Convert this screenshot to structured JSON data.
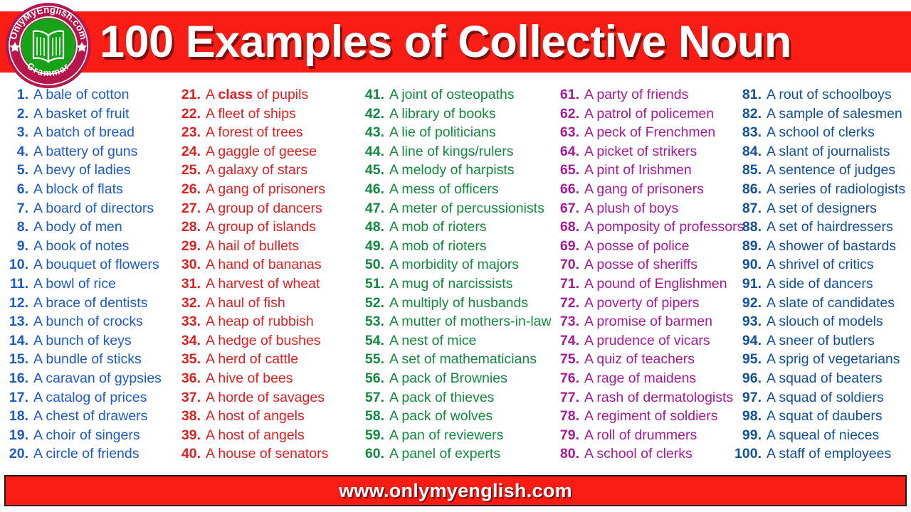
{
  "header": {
    "title": "100 Examples of Collective Noun",
    "background_color": "#F91C15",
    "title_color": "#FFFFFF"
  },
  "logo": {
    "top_text": "OnlyMyEnglish.com",
    "bottom_text": "Grammar",
    "ring_color": "#B5174A",
    "inner_color": "#17A317",
    "icon": "open-book-icon"
  },
  "footer": {
    "url": "www.onlymyenglish.com",
    "background_color": "#F91C15",
    "text_color": "#FFFFFF"
  },
  "columns": [
    {
      "color": "#1A5BC4",
      "items": [
        {
          "num": "1.",
          "text": "A bale of cotton"
        },
        {
          "num": "2.",
          "text": "A basket of fruit"
        },
        {
          "num": "3.",
          "text": "A batch of bread"
        },
        {
          "num": "4.",
          "text": "A battery of guns"
        },
        {
          "num": "5.",
          "text": "A bevy of ladies"
        },
        {
          "num": "6.",
          "text": "A block of flats"
        },
        {
          "num": "7.",
          "text": "A board of directors"
        },
        {
          "num": "8.",
          "text": "A body of men"
        },
        {
          "num": "9.",
          "text": "A book of notes"
        },
        {
          "num": "10.",
          "text": "A bouquet of flowers"
        },
        {
          "num": "11.",
          "text": "A bowl of rice"
        },
        {
          "num": "12.",
          "text": "A brace of dentists"
        },
        {
          "num": "13.",
          "text": "A bunch of crocks"
        },
        {
          "num": "14.",
          "text": "A bunch of keys"
        },
        {
          "num": "15.",
          "text": "A bundle of sticks"
        },
        {
          "num": "16.",
          "text": "A caravan of gypsies"
        },
        {
          "num": "17.",
          "text": "A catalog of prices"
        },
        {
          "num": "18.",
          "text": "A chest of drawers"
        },
        {
          "num": "19.",
          "text": "A choir of singers"
        },
        {
          "num": "20.",
          "text": "A circle of friends"
        }
      ]
    },
    {
      "color": "#E02020",
      "items": [
        {
          "num": "21.",
          "text": "A class of pupils",
          "bold_word": "class"
        },
        {
          "num": "22.",
          "text": "A fleet of ships"
        },
        {
          "num": "23.",
          "text": "A forest of trees"
        },
        {
          "num": "24.",
          "text": "A gaggle of geese"
        },
        {
          "num": "25.",
          "text": "A galaxy of stars"
        },
        {
          "num": "26.",
          "text": "A gang of prisoners"
        },
        {
          "num": "27.",
          "text": "A group of dancers"
        },
        {
          "num": "28.",
          "text": "A group of islands"
        },
        {
          "num": "29.",
          "text": "A hail of bullets"
        },
        {
          "num": "30.",
          "text": "A hand of bananas"
        },
        {
          "num": "31.",
          "text": "A harvest of wheat"
        },
        {
          "num": "32.",
          "text": "A haul of fish"
        },
        {
          "num": "33.",
          "text": "A heap of rubbish"
        },
        {
          "num": "34.",
          "text": "A hedge of bushes"
        },
        {
          "num": "35.",
          "text": "A herd of cattle"
        },
        {
          "num": "36.",
          "text": "A hive of bees"
        },
        {
          "num": "37.",
          "text": "A horde of savages"
        },
        {
          "num": "38.",
          "text": "A host of angels"
        },
        {
          "num": "39.",
          "text": "A host of angels"
        },
        {
          "num": "40.",
          "text": "A house of senators"
        }
      ]
    },
    {
      "color": "#118A3E",
      "items": [
        {
          "num": "41.",
          "text": "A joint of osteopaths"
        },
        {
          "num": "42.",
          "text": "A library of books"
        },
        {
          "num": "43.",
          "text": "A lie of politicians"
        },
        {
          "num": "44.",
          "text": "A line of kings/rulers"
        },
        {
          "num": "45.",
          "text": "A melody of harpists"
        },
        {
          "num": "46.",
          "text": "A mess of officers"
        },
        {
          "num": "47.",
          "text": "A meter of percussionists"
        },
        {
          "num": "48.",
          "text": "A mob of rioters"
        },
        {
          "num": "49.",
          "text": "A mob of rioters"
        },
        {
          "num": "50.",
          "text": "A morbidity of majors"
        },
        {
          "num": "51.",
          "text": "A mug of narcissists"
        },
        {
          "num": "52.",
          "text": "A multiply of husbands"
        },
        {
          "num": "53.",
          "text": "A mutter of mothers-in-law"
        },
        {
          "num": "54.",
          "text": "A nest of mice"
        },
        {
          "num": "55.",
          "text": "A set of mathematicians"
        },
        {
          "num": "56.",
          "text": "A pack of Brownies"
        },
        {
          "num": "57.",
          "text": "A pack of thieves"
        },
        {
          "num": "58.",
          "text": "A pack of wolves"
        },
        {
          "num": "59.",
          "text": "A pan of reviewers"
        },
        {
          "num": "60.",
          "text": "A panel of experts"
        }
      ]
    },
    {
      "color": "#A8199A",
      "items": [
        {
          "num": "61.",
          "text": "A party of friends"
        },
        {
          "num": "62.",
          "text": "A patrol of policemen"
        },
        {
          "num": "63.",
          "text": "A peck of Frenchmen"
        },
        {
          "num": "64.",
          "text": "A picket of strikers"
        },
        {
          "num": "65.",
          "text": "A pint of Irishmen"
        },
        {
          "num": "66.",
          "text": "A gang of prisoners"
        },
        {
          "num": "67.",
          "text": "A plush of boys"
        },
        {
          "num": "68.",
          "text": "A pomposity of professors"
        },
        {
          "num": "69.",
          "text": "A posse of police"
        },
        {
          "num": "70.",
          "text": "A posse of sheriffs"
        },
        {
          "num": "71.",
          "text": "A pound of Englishmen"
        },
        {
          "num": "72.",
          "text": "A poverty of pipers"
        },
        {
          "num": "73.",
          "text": "A promise of barmen"
        },
        {
          "num": "74.",
          "text": "A prudence of vicars"
        },
        {
          "num": "75.",
          "text": "A quiz of teachers"
        },
        {
          "num": "76.",
          "text": "A rage of maidens"
        },
        {
          "num": "77.",
          "text": "A rash of dermatologists"
        },
        {
          "num": "78.",
          "text": "A regiment of soldiers"
        },
        {
          "num": "79.",
          "text": "A roll of drummers"
        },
        {
          "num": "80.",
          "text": "A school of clerks"
        }
      ]
    },
    {
      "color": "#10519B",
      "items": [
        {
          "num": "81.",
          "text": "A rout of schoolboys"
        },
        {
          "num": "82.",
          "text": "A sample of salesmen"
        },
        {
          "num": "83.",
          "text": "A school of clerks"
        },
        {
          "num": "84.",
          "text": "A slant of journalists"
        },
        {
          "num": "85.",
          "text": "A sentence of judges"
        },
        {
          "num": "86.",
          "text": "A series of radiologists"
        },
        {
          "num": "87.",
          "text": "A set of designers"
        },
        {
          "num": "88.",
          "text": "A set of hairdressers"
        },
        {
          "num": "89.",
          "text": "A shower of bastards"
        },
        {
          "num": "90.",
          "text": "A shrivel of critics"
        },
        {
          "num": "91.",
          "text": "A side of dancers"
        },
        {
          "num": "92.",
          "text": "A slate of candidates"
        },
        {
          "num": "93.",
          "text": "A slouch of models"
        },
        {
          "num": "94.",
          "text": "A sneer of butlers"
        },
        {
          "num": "95.",
          "text": "A sprig of vegetarians"
        },
        {
          "num": "96.",
          "text": "A squad of beaters"
        },
        {
          "num": "97.",
          "text": "A squad of soldiers"
        },
        {
          "num": "98.",
          "text": "A squat of daubers"
        },
        {
          "num": "99.",
          "text": "A squeal of nieces"
        },
        {
          "num": "100.",
          "text": "A staff of employees"
        }
      ]
    }
  ]
}
